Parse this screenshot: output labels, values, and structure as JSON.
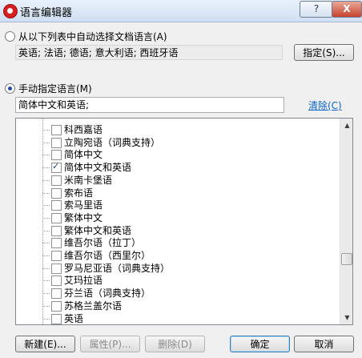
{
  "window": {
    "title": "语言编辑器",
    "help_label": "?",
    "close_label": "X"
  },
  "auto_select": {
    "label": "从以下列表中自动选择文档语言(A)",
    "languages_text": "英语; 法语; 德语; 意大利语; 西班牙语",
    "specify_button": "指定(S)..."
  },
  "manual": {
    "label": "手动指定语言(M)",
    "input_value": "简体中文和英语;",
    "clear_link": "清除(C)"
  },
  "languages": [
    {
      "label": "科西嘉语",
      "checked": false
    },
    {
      "label": "立陶宛语（词典支持）",
      "checked": false
    },
    {
      "label": "简体中文",
      "checked": false
    },
    {
      "label": "简体中文和英语",
      "checked": true
    },
    {
      "label": "米南卡堡语",
      "checked": false
    },
    {
      "label": "索布语",
      "checked": false
    },
    {
      "label": "索马里语",
      "checked": false
    },
    {
      "label": "繁体中文",
      "checked": false
    },
    {
      "label": "繁体中文和英语",
      "checked": false
    },
    {
      "label": "维吾尔语（拉丁）",
      "checked": false
    },
    {
      "label": "维吾尔语（西里尔）",
      "checked": false
    },
    {
      "label": "罗马尼亚语（词典支持）",
      "checked": false
    },
    {
      "label": "艾玛拉语",
      "checked": false
    },
    {
      "label": "芬兰语（词典支持）",
      "checked": false
    },
    {
      "label": "苏格兰盖尔语",
      "checked": false
    },
    {
      "label": "英语",
      "checked": false
    }
  ],
  "buttons": {
    "new": "新建(E)...",
    "properties": "属性(P)...",
    "delete": "删除(D)",
    "ok": "确定",
    "cancel": "取消"
  },
  "icons": {
    "scroll_up": "▲",
    "scroll_down": "▼"
  },
  "colors": {
    "accent": "#1f4f9e",
    "link": "#0a64c8",
    "close": "#c7422d"
  }
}
